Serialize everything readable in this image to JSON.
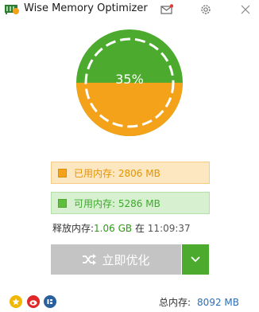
{
  "app": {
    "title": "Wise Memory Optimizer"
  },
  "gauge": {
    "percent_label": "35%",
    "used_fraction": 0.35,
    "colors": {
      "used": "#f5a21b",
      "free": "#4cab2f"
    }
  },
  "memory": {
    "used_label": "已用内存: 2806 MB",
    "available_label": "可用内存: 5286 MB"
  },
  "release": {
    "label": "释放内存:",
    "value": "1.06 GB",
    "at": "在",
    "time": "11:09:37"
  },
  "optimize": {
    "button_label": "立即优化"
  },
  "footer": {
    "total_label": "总内存:",
    "total_value": "8092 MB"
  },
  "icons": [
    "app-logo-icon",
    "mail-icon",
    "gear-icon",
    "close-icon",
    "shuffle-icon",
    "chevron-down-icon",
    "star-icon",
    "weibo-icon",
    "brand-icon"
  ]
}
